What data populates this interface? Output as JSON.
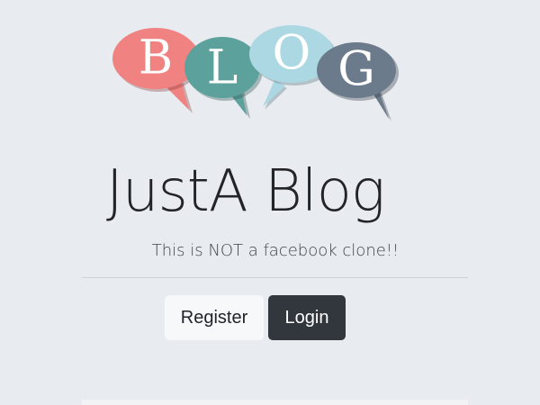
{
  "logo": {
    "letters": [
      "B",
      "L",
      "O",
      "G"
    ],
    "colors": [
      "#f08282",
      "#5da19c",
      "#acd8e4",
      "#6c7b8c"
    ]
  },
  "header": {
    "title": "JustA Blog",
    "subtitle": "This is NOT a facebook clone!!"
  },
  "actions": {
    "register_label": "Register",
    "login_label": "Login"
  }
}
